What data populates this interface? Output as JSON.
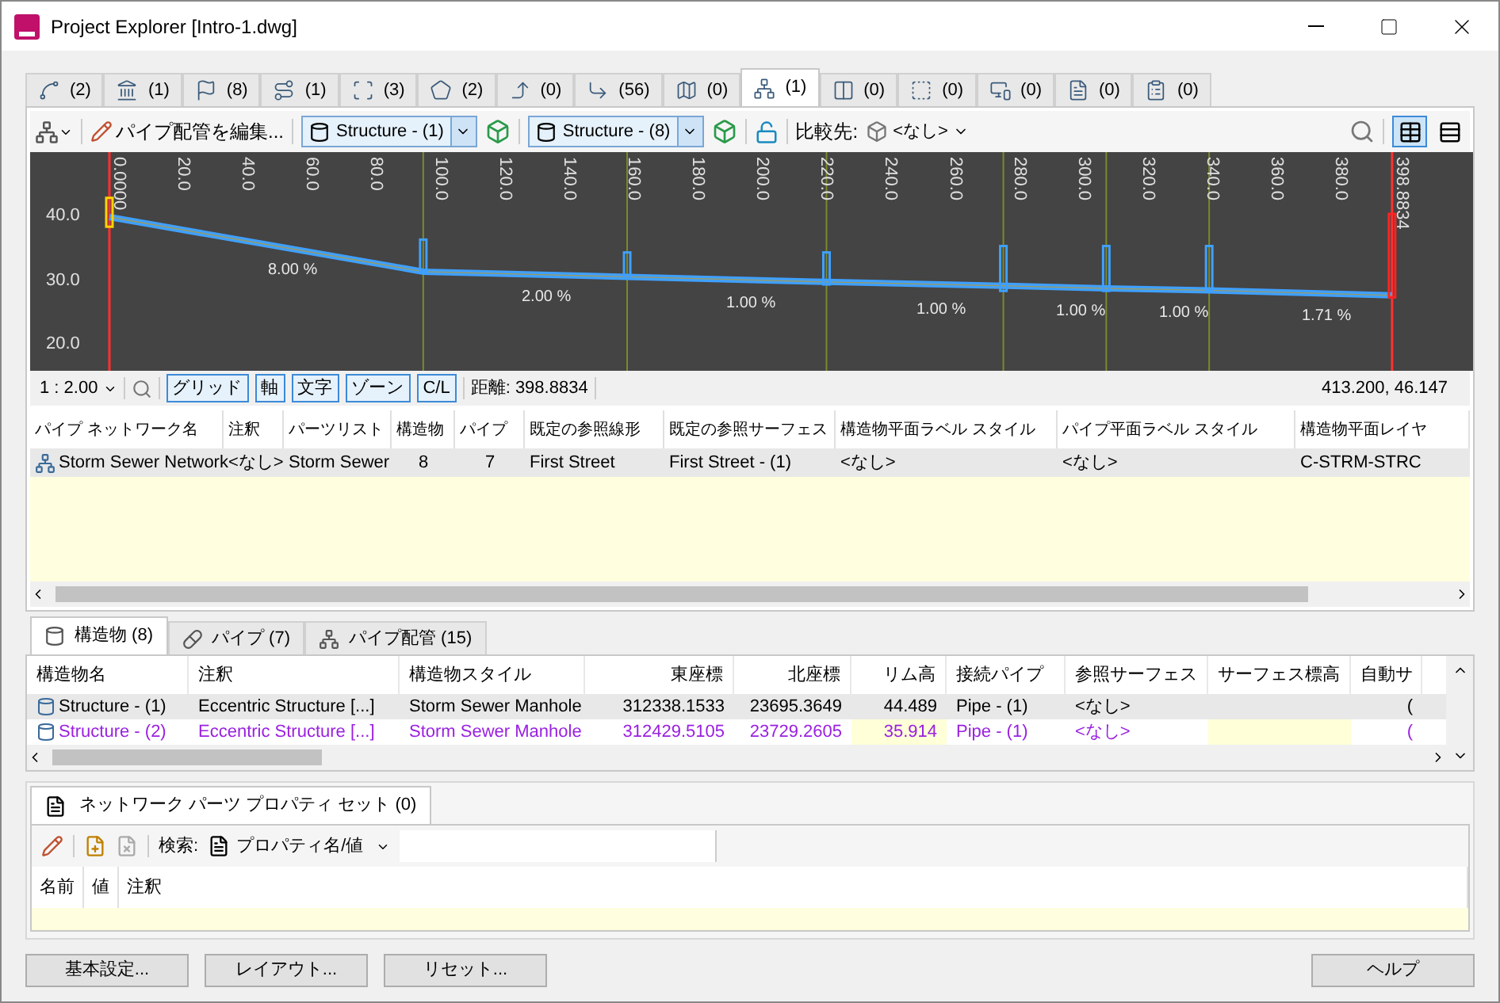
{
  "window": {
    "title": "Project Explorer [Intro-1.dwg]"
  },
  "tabs": [
    {
      "count": "(2)",
      "selected": false
    },
    {
      "count": "(1)",
      "selected": false
    },
    {
      "count": "(8)",
      "selected": false
    },
    {
      "count": "(1)",
      "selected": false
    },
    {
      "count": "(3)",
      "selected": false
    },
    {
      "count": "(2)",
      "selected": false
    },
    {
      "count": "(0)",
      "selected": false
    },
    {
      "count": "(56)",
      "selected": false
    },
    {
      "count": "(0)",
      "selected": false
    },
    {
      "count": "(1)",
      "selected": true
    },
    {
      "count": "(0)",
      "selected": false
    },
    {
      "count": "(0)",
      "selected": false
    },
    {
      "count": "(0)",
      "selected": false
    },
    {
      "count": "(0)",
      "selected": false
    },
    {
      "count": "(0)",
      "selected": false
    }
  ],
  "toolbar": {
    "edit_label": "パイプ配管を編集...",
    "structure_a": "Structure - (1)",
    "structure_b": "Structure - (8)",
    "compare_label": "比較先:",
    "compare_value": "<なし>",
    "views": [
      {
        "selected": true
      },
      {
        "selected": false
      }
    ]
  },
  "profile": {
    "elevations": [
      "40.0",
      "30.0",
      "20.0"
    ],
    "stations": [
      "0.0000",
      "20.0",
      "40.0",
      "60.0",
      "80.0",
      "100.0",
      "120.0",
      "140.0",
      "160.0",
      "180.0",
      "200.0",
      "220.0",
      "240.0",
      "260.0",
      "280.0",
      "300.0",
      "320.0",
      "340.0",
      "360.0",
      "380.0",
      "398.8834"
    ],
    "slopes": [
      "8.00 %",
      "2.00 %",
      "1.00 %",
      "1.00 %",
      "1.00 %",
      "1.00 %",
      "1.71 %"
    ],
    "scale": "1 : 2.00",
    "toggles": [
      {
        "label": "グリッド",
        "on": true
      },
      {
        "label": "軸",
        "on": true
      },
      {
        "label": "文字",
        "on": true
      },
      {
        "label": "ゾーン",
        "on": true
      },
      {
        "label": "C/L",
        "on": true
      }
    ],
    "distance": "距離: 398.8834",
    "coords": "413.200, 46.147"
  },
  "network_table": {
    "columns": [
      "パイプ ネットワーク名",
      "注釈",
      "パーツリスト",
      "構造物",
      "パイプ",
      "既定の参照線形",
      "既定の参照サーフェス",
      "構造物平面ラベル スタイル",
      "パイプ平面ラベル スタイル",
      "構造物平面レイヤ"
    ],
    "rows": [
      [
        "Storm Sewer Network",
        "<なし>",
        "Storm Sewer",
        "8",
        "7",
        "First Street",
        "First Street - (1)",
        "<なし>",
        "<なし>",
        "C-STRM-STRC"
      ]
    ]
  },
  "part_tabs": [
    {
      "label": "構造物 (8)",
      "selected": true
    },
    {
      "label": "パイプ (7)",
      "selected": false
    },
    {
      "label": "パイプ配管 (15)",
      "selected": false
    }
  ],
  "structure_table": {
    "columns": [
      "構造物名",
      "注釈",
      "構造物スタイル",
      "東座標",
      "北座標",
      "リム高",
      "接続パイプ",
      "参照サーフェス",
      "サーフェス標高",
      "自動サ"
    ],
    "rows": [
      {
        "highlighted": false,
        "cells": [
          "Structure - (1)",
          "Eccentric Structure  [...]",
          "Storm Sewer Manhole",
          "312338.1533",
          "23695.3649",
          "44.489",
          "Pipe - (1)",
          "<なし>",
          "",
          "("
        ]
      },
      {
        "highlighted": true,
        "cells": [
          "Structure - (2)",
          "Eccentric Structure  [...]",
          "Storm Sewer Manhole",
          "312429.5105",
          "23729.2605",
          "35.914",
          "Pipe - (1)",
          "<なし>",
          "",
          "("
        ]
      }
    ]
  },
  "property_set": {
    "tab": "ネットワーク パーツ プロパティ セット (0)",
    "search_label": "検索:",
    "search_mode": "プロパティ名/値",
    "columns": [
      "名前",
      "値",
      "注釈"
    ]
  },
  "buttons": [
    "基本設定...",
    "レイアウト...",
    "リセット...",
    "ヘルプ"
  ]
}
